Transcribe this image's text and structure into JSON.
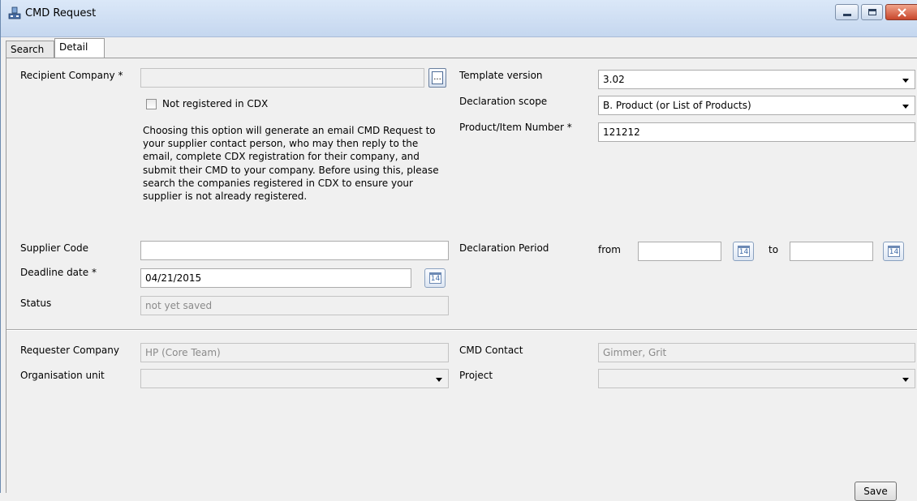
{
  "window": {
    "title": "CMD Request",
    "icon": "app-icon",
    "controls": [
      "minimize-icon",
      "maximize-icon",
      "close-icon"
    ]
  },
  "tabs": [
    {
      "label": "Search",
      "active": false
    },
    {
      "label": "Detail",
      "active": true
    }
  ],
  "left": {
    "recipient_company_label": "Recipient Company *",
    "recipient_company_value": "",
    "not_registered_label": "Not registered in CDX",
    "not_registered_checked": false,
    "description": "Choosing this option will generate an email CMD Request to your supplier contact person, who may then reply to the email, complete CDX registration for their company, and submit their CMD to your company.  Before using this, please search the companies registered in CDX to ensure your supplier is not already registered.",
    "supplier_code_label": "Supplier Code",
    "supplier_code_value": "",
    "deadline_label": "Deadline date *",
    "deadline_value": "04/21/2015",
    "status_label": "Status",
    "status_value": "not yet saved"
  },
  "right": {
    "template_version_label": "Template version",
    "template_version_value": "3.02",
    "declaration_scope_label": "Declaration scope",
    "declaration_scope_value": "B. Product (or List of Products)",
    "product_number_label": "Product/Item Number *",
    "product_number_value": "121212",
    "declaration_period_label": "Declaration Period",
    "from_label": "from",
    "from_value": "",
    "to_label": "to",
    "to_value": ""
  },
  "bottom": {
    "requester_company_label": "Requester Company",
    "requester_company_value": "HP (Core Team)",
    "org_unit_label": "Organisation unit",
    "org_unit_value": "",
    "cmd_contact_label": "CMD Contact",
    "cmd_contact_value": "Gimmer, Grit",
    "project_label": "Project",
    "project_value": ""
  },
  "calendar_icon_text": "14",
  "browse_icon_text": "...",
  "save_label": "Save"
}
